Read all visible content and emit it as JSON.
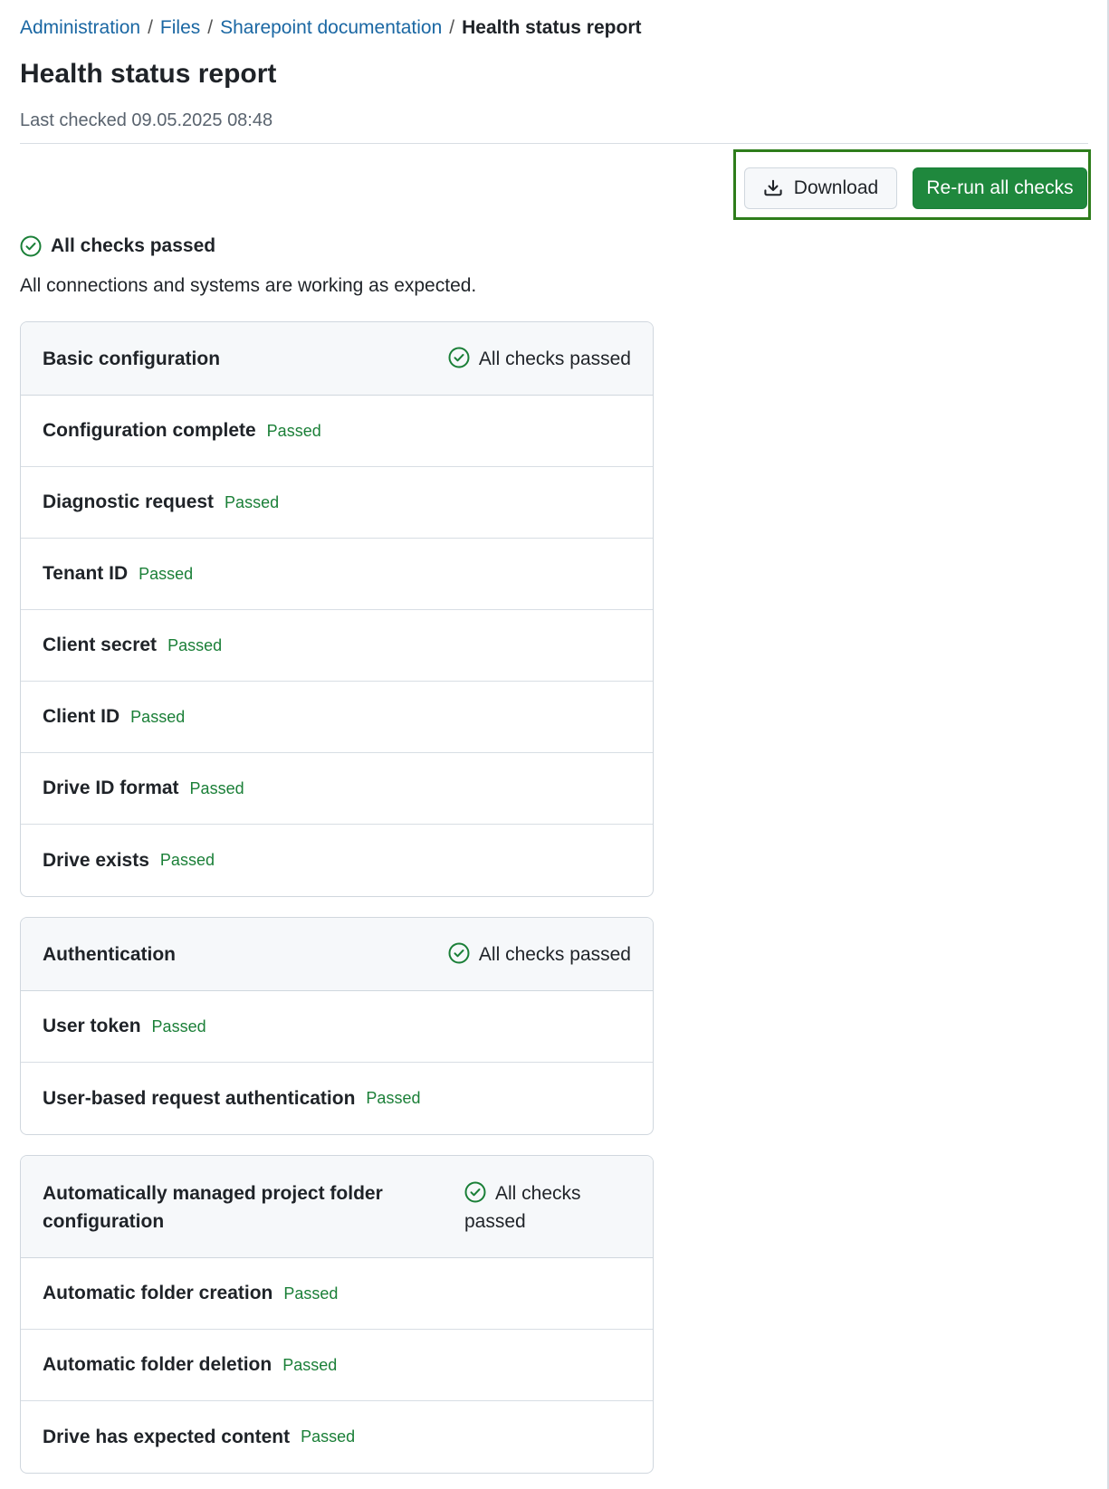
{
  "breadcrumb": {
    "items": [
      "Administration",
      "Files",
      "Sharepoint documentation"
    ],
    "current": "Health status report",
    "separator": "/"
  },
  "page": {
    "title": "Health status report",
    "last_checked": "Last checked 09.05.2025 08:48"
  },
  "toolbar": {
    "download_label": "Download",
    "download_icon": "download-icon",
    "rerun_label": "Re-run all checks"
  },
  "summary": {
    "title": "All checks passed",
    "description": "All connections and systems are working as expected.",
    "icon": "check-circle-icon"
  },
  "groups": [
    {
      "title": "Basic configuration",
      "status": "All checks passed",
      "checks": [
        {
          "name": "Configuration complete",
          "status": "Passed"
        },
        {
          "name": "Diagnostic request",
          "status": "Passed"
        },
        {
          "name": "Tenant ID",
          "status": "Passed"
        },
        {
          "name": "Client secret",
          "status": "Passed"
        },
        {
          "name": "Client ID",
          "status": "Passed"
        },
        {
          "name": "Drive ID format",
          "status": "Passed"
        },
        {
          "name": "Drive exists",
          "status": "Passed"
        }
      ]
    },
    {
      "title": "Authentication",
      "status": "All checks passed",
      "checks": [
        {
          "name": "User token",
          "status": "Passed"
        },
        {
          "name": "User-based request authentication",
          "status": "Passed"
        }
      ]
    },
    {
      "title": "Automatically managed project folder configuration",
      "status": "All checks passed",
      "checks": [
        {
          "name": "Automatic folder creation",
          "status": "Passed"
        },
        {
          "name": "Automatic folder deletion",
          "status": "Passed"
        },
        {
          "name": "Drive has expected content",
          "status": "Passed"
        }
      ]
    }
  ],
  "colors": {
    "link": "#1a67a3",
    "success": "#1a7f37",
    "primary_button": "#1f883d",
    "highlight_border": "#2e7d1b"
  }
}
